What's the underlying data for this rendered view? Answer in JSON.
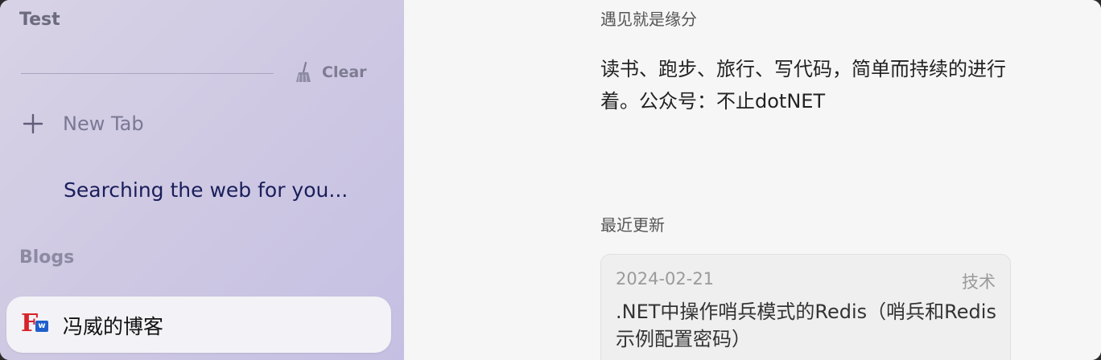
{
  "sidebar": {
    "section_test": "Test",
    "clear_label": "Clear",
    "new_tab_label": "New Tab",
    "searching_text": "Searching the web for you...",
    "section_blogs": "Blogs",
    "blog_item": {
      "label": "冯威的博客",
      "favicon_letters": "F",
      "favicon_badge": "w"
    }
  },
  "main": {
    "meet_heading": "遇见就是缘分",
    "bio": "读书、跑步、旅行、写代码，简单而持续的进行着。公众号：不止dotNET",
    "recent_heading": "最近更新",
    "post": {
      "date": "2024-02-21",
      "tag": "技术",
      "title": ".NET中操作哨兵模式的Redis（哨兵和Redis示例配置密码）"
    }
  },
  "colors": {
    "sidebar_tint": "#cfc9e3",
    "searching_text": "#1a1e5a",
    "favicon_red": "#d8222a",
    "favicon_blue": "#1e5fcc"
  }
}
